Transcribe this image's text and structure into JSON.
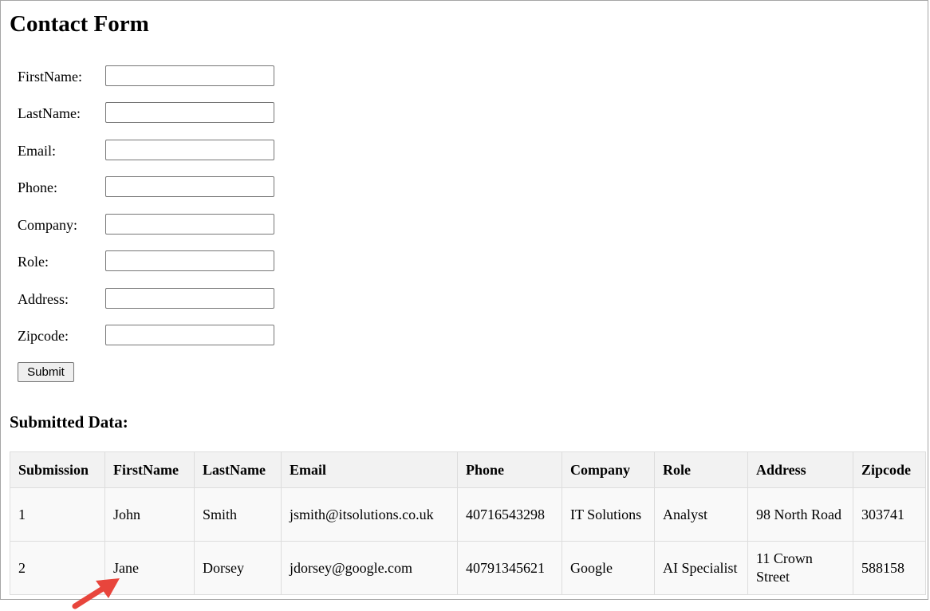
{
  "page": {
    "title": "Contact Form",
    "submitted_heading": "Submitted Data:"
  },
  "form": {
    "fields": [
      {
        "label": "FirstName:",
        "value": ""
      },
      {
        "label": "LastName:",
        "value": ""
      },
      {
        "label": "Email:",
        "value": ""
      },
      {
        "label": "Phone:",
        "value": ""
      },
      {
        "label": "Company:",
        "value": ""
      },
      {
        "label": "Role:",
        "value": ""
      },
      {
        "label": "Address:",
        "value": ""
      },
      {
        "label": "Zipcode:",
        "value": ""
      }
    ],
    "submit_label": "Submit"
  },
  "table": {
    "headers": [
      "Submission",
      "FirstName",
      "LastName",
      "Email",
      "Phone",
      "Company",
      "Role",
      "Address",
      "Zipcode"
    ],
    "rows": [
      [
        "1",
        "John",
        "Smith",
        "jsmith@itsolutions.co.uk",
        "40716543298",
        "IT Solutions",
        "Analyst",
        "98 North Road",
        "303741"
      ],
      [
        "2",
        "Jane",
        "Dorsey",
        "jdorsey@google.com",
        "40791345621",
        "Google",
        "AI Specialist",
        "11 Crown Street",
        "588158"
      ]
    ]
  },
  "annotation": {
    "arrow_icon": "arrow-icon",
    "arrow_color": "#e8453c"
  }
}
